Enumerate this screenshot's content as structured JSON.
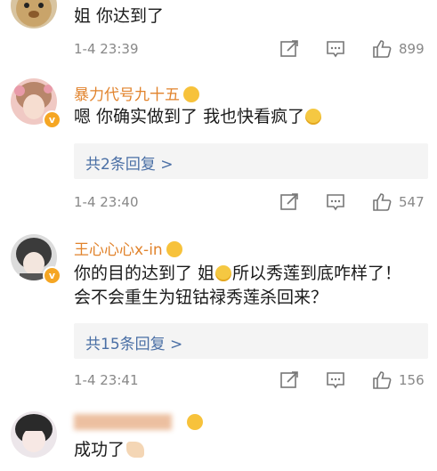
{
  "comments": [
    {
      "avatar": "bear-avatar",
      "username": "",
      "text": "姐 你达到了",
      "time": "1-4 23:39",
      "likes": "899"
    },
    {
      "avatar": "girl-pink-avatar",
      "username": "暴力代号九十五",
      "text_before": "嗯 你确实做到了 我也快看疯了",
      "replies": "共2条回复 >",
      "time": "1-4 23:40",
      "likes": "547"
    },
    {
      "avatar": "girl-grey-avatar",
      "username": "王心心心x-in",
      "line1_before": "你的目的达到了 姐",
      "line1_after": "所以秀莲到底咋样了！",
      "line2": "会不会重生为钮钴禄秀莲杀回来？",
      "replies": "共15条回复 >",
      "time": "1-4 23:41",
      "likes": "156"
    },
    {
      "avatar": "girl-bangs-avatar",
      "text": "成功了"
    }
  ],
  "icons": {
    "share": "share-icon",
    "comment": "comment-icon",
    "like": "thumbs-up-icon",
    "badge": "verified-badge-icon",
    "emoji": "smiley-emoji-icon",
    "clap": "clap-emoji-icon"
  },
  "colors": {
    "username": "#e1832c",
    "reply_link": "#4a6fa5",
    "meta": "#888888",
    "reply_bg": "#f4f4f4"
  }
}
